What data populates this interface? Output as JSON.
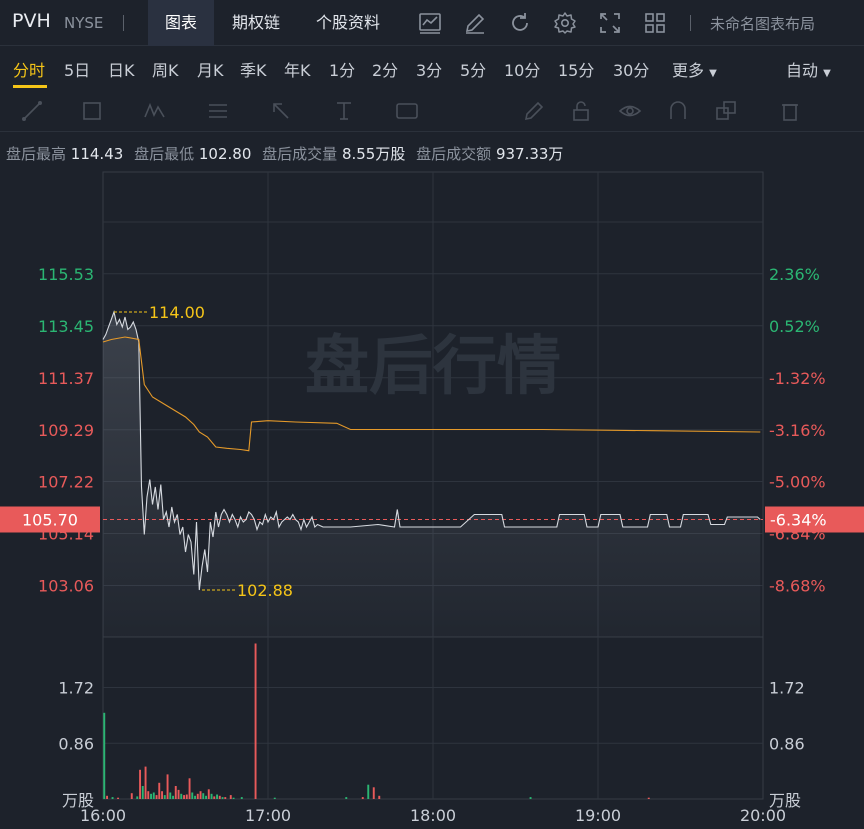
{
  "header": {
    "symbol": "PVH",
    "exchange": "NYSE",
    "tabs": [
      {
        "label": "图表",
        "active": true
      },
      {
        "label": "期权链",
        "active": false
      },
      {
        "label": "个股资料",
        "active": false
      }
    ],
    "icons": [
      "line-chart-icon",
      "edit-icon",
      "refresh-icon",
      "gear-icon",
      "fullscreen-icon",
      "grid-layout-icon"
    ],
    "layout_name": "未命名图表布局"
  },
  "periods": {
    "items": [
      "分时",
      "5日",
      "日K",
      "周K",
      "月K",
      "季K",
      "年K",
      "1分",
      "2分",
      "3分",
      "5分",
      "10分",
      "15分",
      "30分",
      "更多"
    ],
    "active": "分时",
    "scale_mode": "自动"
  },
  "draw_tools": [
    "line-tool-icon",
    "rect-tool-icon",
    "wave-tool-icon",
    "fib-tool-icon",
    "arrow-tool-icon",
    "text-tool-icon",
    "label-tool-icon",
    "pen-icon",
    "lock-icon",
    "eye-icon",
    "magnet-icon",
    "layers-icon",
    "trash-icon"
  ],
  "info_bar": [
    {
      "label": "盘后最高",
      "value": "114.43"
    },
    {
      "label": "盘后最低",
      "value": "102.80"
    },
    {
      "label": "盘后成交量",
      "value": "8.55万股"
    },
    {
      "label": "盘后成交额",
      "value": "937.33万"
    }
  ],
  "colors": {
    "up": "#2bb673",
    "down": "#e85a5a",
    "accent": "#f5c518",
    "avg_line": "#e59a2a",
    "price_line": "#d6dae0"
  },
  "chart_data": {
    "type": "line",
    "watermark": "盘后行情",
    "x_ticks": [
      "16:00",
      "17:00",
      "18:00",
      "19:00",
      "20:00"
    ],
    "xlim": [
      0,
      240
    ],
    "price_axis": {
      "ticks": [
        "115.53",
        "113.45",
        "111.37",
        "109.29",
        "107.22",
        "105.14",
        "103.06"
      ],
      "tick_values": [
        115.53,
        113.45,
        111.37,
        109.29,
        107.22,
        105.14,
        103.06
      ],
      "ylim": [
        101.0,
        119.6
      ],
      "up_ticks": [
        "115.53",
        "113.45"
      ]
    },
    "percent_axis": {
      "ticks": [
        "2.36%",
        "0.52%",
        "-1.32%",
        "-3.16%",
        "-5.00%",
        "-6.84%",
        "-8.68%"
      ],
      "up_ticks": [
        "2.36%",
        "0.52%"
      ]
    },
    "current": {
      "price": "105.70",
      "percent": "-6.34%",
      "value": 105.7
    },
    "annotations": [
      {
        "label": "114.00",
        "x": 4,
        "y": 114.0
      },
      {
        "label": "102.88",
        "x": 36,
        "y": 102.88
      }
    ],
    "series": [
      {
        "kind": "price",
        "points": [
          [
            0,
            112.9
          ],
          [
            1,
            113.1
          ],
          [
            2,
            113.4
          ],
          [
            3,
            113.7
          ],
          [
            4,
            114.0
          ],
          [
            5,
            113.5
          ],
          [
            6,
            113.7
          ],
          [
            7,
            113.4
          ],
          [
            8,
            113.8
          ],
          [
            9,
            113.3
          ],
          [
            10,
            113.4
          ],
          [
            11,
            113.6
          ],
          [
            12,
            113.3
          ],
          [
            13,
            112.8
          ],
          [
            14,
            107.0
          ],
          [
            15,
            105.1
          ],
          [
            16,
            106.6
          ],
          [
            17,
            107.3
          ],
          [
            18,
            106.3
          ],
          [
            19,
            107.0
          ],
          [
            20,
            106.1
          ],
          [
            21,
            107.1
          ],
          [
            22,
            105.7
          ],
          [
            23,
            106.0
          ],
          [
            24,
            105.4
          ],
          [
            25,
            106.2
          ],
          [
            26,
            105.6
          ],
          [
            27,
            105.9
          ],
          [
            28,
            105.1
          ],
          [
            29,
            105.4
          ],
          [
            30,
            104.4
          ],
          [
            31,
            105.1
          ],
          [
            32,
            104.8
          ],
          [
            33,
            103.5
          ],
          [
            34,
            105.6
          ],
          [
            35,
            102.88
          ],
          [
            36,
            103.8
          ],
          [
            37,
            104.5
          ],
          [
            38,
            103.6
          ],
          [
            39,
            105.6
          ],
          [
            40,
            105.0
          ],
          [
            41,
            106.0
          ],
          [
            42,
            105.4
          ],
          [
            43,
            105.9
          ],
          [
            44,
            106.1
          ],
          [
            45,
            105.9
          ],
          [
            46,
            105.6
          ],
          [
            47,
            105.9
          ],
          [
            48,
            105.7
          ],
          [
            49,
            105.4
          ],
          [
            50,
            105.8
          ],
          [
            51,
            105.6
          ],
          [
            52,
            105.7
          ],
          [
            53,
            106.0
          ],
          [
            54,
            105.9
          ],
          [
            55,
            105.7
          ],
          [
            56,
            105.3
          ],
          [
            57,
            105.6
          ],
          [
            58,
            105.5
          ],
          [
            59,
            105.9
          ],
          [
            60,
            105.6
          ],
          [
            61,
            105.8
          ],
          [
            62,
            105.7
          ],
          [
            63,
            106.0
          ],
          [
            64,
            105.4
          ],
          [
            65,
            105.6
          ],
          [
            66,
            105.7
          ],
          [
            67,
            105.8
          ],
          [
            68,
            105.7
          ],
          [
            69,
            105.9
          ],
          [
            70,
            105.7
          ],
          [
            71,
            105.6
          ],
          [
            72,
            105.3
          ],
          [
            73,
            105.7
          ],
          [
            74,
            105.4
          ],
          [
            75,
            105.6
          ],
          [
            76,
            105.8
          ],
          [
            77,
            105.4
          ],
          [
            78,
            105.5
          ],
          [
            80,
            105.4
          ],
          [
            90,
            105.4
          ],
          [
            100,
            105.5
          ],
          [
            106,
            105.4
          ],
          [
            107,
            106.1
          ],
          [
            108,
            105.4
          ],
          [
            120,
            105.4
          ],
          [
            130,
            105.4
          ],
          [
            135,
            105.9
          ],
          [
            145,
            105.9
          ],
          [
            146,
            105.4
          ],
          [
            155,
            105.4
          ],
          [
            165,
            105.4
          ],
          [
            166,
            105.9
          ],
          [
            175,
            105.9
          ],
          [
            176,
            105.4
          ],
          [
            180,
            105.4
          ],
          [
            181,
            105.9
          ],
          [
            188,
            105.9
          ],
          [
            189,
            105.4
          ],
          [
            198,
            105.4
          ],
          [
            199,
            105.9
          ],
          [
            205,
            105.9
          ],
          [
            206,
            105.4
          ],
          [
            210,
            105.4
          ],
          [
            211,
            105.9
          ],
          [
            220,
            105.9
          ],
          [
            221,
            105.5
          ],
          [
            226,
            105.5
          ],
          [
            227,
            105.8
          ],
          [
            238,
            105.8
          ],
          [
            239,
            105.7
          ]
        ]
      },
      {
        "kind": "average",
        "points": [
          [
            0,
            112.8
          ],
          [
            3,
            112.9
          ],
          [
            8,
            113.0
          ],
          [
            13,
            112.9
          ],
          [
            15,
            111.1
          ],
          [
            18,
            110.6
          ],
          [
            24,
            110.2
          ],
          [
            30,
            109.8
          ],
          [
            33,
            109.5
          ],
          [
            35,
            109.2
          ],
          [
            38,
            109.0
          ],
          [
            41,
            108.6
          ],
          [
            45,
            108.55
          ],
          [
            50,
            108.5
          ],
          [
            53,
            108.45
          ],
          [
            54,
            109.6
          ],
          [
            60,
            109.65
          ],
          [
            70,
            109.6
          ],
          [
            85,
            109.55
          ],
          [
            90,
            109.3
          ],
          [
            120,
            109.3
          ],
          [
            160,
            109.3
          ],
          [
            200,
            109.25
          ],
          [
            239,
            109.2
          ]
        ]
      }
    ],
    "volume_axis": {
      "ticks": [
        "1.72",
        "0.86",
        "万股"
      ],
      "tick_values": [
        1.72,
        0.86,
        0
      ],
      "ylim": [
        0,
        2.5
      ],
      "unit": "万股"
    },
    "volume_bars": [
      {
        "x": 0,
        "v": 1.33,
        "dir": "up"
      },
      {
        "x": 1,
        "v": 0.05,
        "dir": "down"
      },
      {
        "x": 3,
        "v": 0.03,
        "dir": "up"
      },
      {
        "x": 5,
        "v": 0.02,
        "dir": "down"
      },
      {
        "x": 10,
        "v": 0.09,
        "dir": "down"
      },
      {
        "x": 12,
        "v": 0.04,
        "dir": "up"
      },
      {
        "x": 13,
        "v": 0.45,
        "dir": "down"
      },
      {
        "x": 14,
        "v": 0.2,
        "dir": "up"
      },
      {
        "x": 15,
        "v": 0.5,
        "dir": "down"
      },
      {
        "x": 16,
        "v": 0.12,
        "dir": "down"
      },
      {
        "x": 17,
        "v": 0.08,
        "dir": "up"
      },
      {
        "x": 18,
        "v": 0.1,
        "dir": "up"
      },
      {
        "x": 19,
        "v": 0.06,
        "dir": "down"
      },
      {
        "x": 20,
        "v": 0.25,
        "dir": "down"
      },
      {
        "x": 21,
        "v": 0.12,
        "dir": "down"
      },
      {
        "x": 22,
        "v": 0.06,
        "dir": "up"
      },
      {
        "x": 23,
        "v": 0.38,
        "dir": "down"
      },
      {
        "x": 24,
        "v": 0.1,
        "dir": "up"
      },
      {
        "x": 25,
        "v": 0.05,
        "dir": "up"
      },
      {
        "x": 26,
        "v": 0.2,
        "dir": "down"
      },
      {
        "x": 27,
        "v": 0.14,
        "dir": "down"
      },
      {
        "x": 28,
        "v": 0.08,
        "dir": "up"
      },
      {
        "x": 29,
        "v": 0.06,
        "dir": "down"
      },
      {
        "x": 30,
        "v": 0.07,
        "dir": "down"
      },
      {
        "x": 31,
        "v": 0.32,
        "dir": "down"
      },
      {
        "x": 32,
        "v": 0.1,
        "dir": "up"
      },
      {
        "x": 33,
        "v": 0.05,
        "dir": "up"
      },
      {
        "x": 34,
        "v": 0.08,
        "dir": "down"
      },
      {
        "x": 35,
        "v": 0.12,
        "dir": "down"
      },
      {
        "x": 36,
        "v": 0.09,
        "dir": "up"
      },
      {
        "x": 37,
        "v": 0.05,
        "dir": "up"
      },
      {
        "x": 38,
        "v": 0.15,
        "dir": "down"
      },
      {
        "x": 39,
        "v": 0.08,
        "dir": "up"
      },
      {
        "x": 40,
        "v": 0.04,
        "dir": "down"
      },
      {
        "x": 41,
        "v": 0.07,
        "dir": "up"
      },
      {
        "x": 42,
        "v": 0.05,
        "dir": "down"
      },
      {
        "x": 43,
        "v": 0.03,
        "dir": "up"
      },
      {
        "x": 44,
        "v": 0.03,
        "dir": "down"
      },
      {
        "x": 46,
        "v": 0.06,
        "dir": "down"
      },
      {
        "x": 47,
        "v": 0.02,
        "dir": "up"
      },
      {
        "x": 50,
        "v": 0.03,
        "dir": "up"
      },
      {
        "x": 55,
        "v": 2.4,
        "dir": "down"
      },
      {
        "x": 62,
        "v": 0.02,
        "dir": "up"
      },
      {
        "x": 88,
        "v": 0.03,
        "dir": "up"
      },
      {
        "x": 94,
        "v": 0.03,
        "dir": "down"
      },
      {
        "x": 96,
        "v": 0.22,
        "dir": "up"
      },
      {
        "x": 98,
        "v": 0.18,
        "dir": "down"
      },
      {
        "x": 100,
        "v": 0.05,
        "dir": "down"
      },
      {
        "x": 155,
        "v": 0.03,
        "dir": "up"
      },
      {
        "x": 198,
        "v": 0.02,
        "dir": "down"
      }
    ]
  }
}
